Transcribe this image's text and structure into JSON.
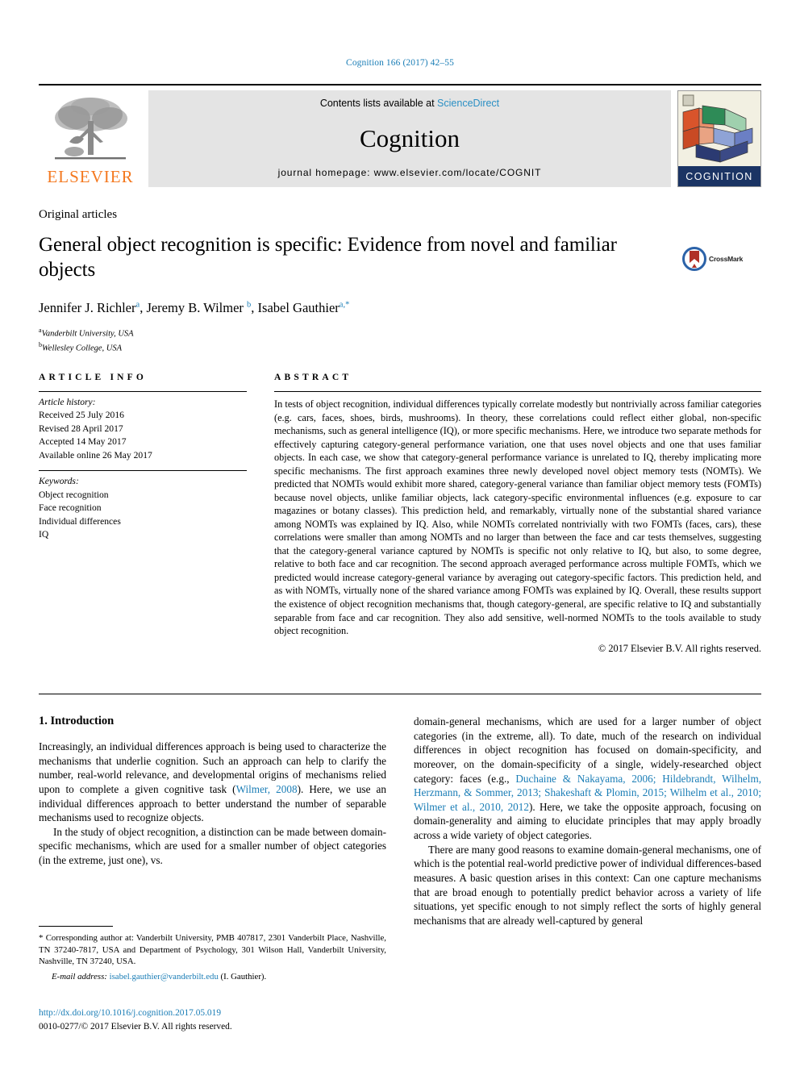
{
  "running_head": "Cognition 166 (2017) 42–55",
  "masthead": {
    "contents_prefix": "Contents lists available at ",
    "contents_link": "ScienceDirect",
    "journal_name": "Cognition",
    "homepage": "journal homepage: www.elsevier.com/locate/COGNIT",
    "publisher_logo_text": "ELSEVIER",
    "cover_band_text": "COGNITION",
    "link_color": "#2a8fc4"
  },
  "article": {
    "article_class": "Original articles",
    "title": "General object recognition is specific: Evidence from novel and familiar objects",
    "crossmark_label": "CrossMark",
    "authors_html": "Jennifer J. Richler<sup>a</sup>, Jeremy B. Wilmer <sup>b</sup>, Isabel Gauthier<sup>a,*</sup>",
    "affiliations": [
      {
        "marker": "a",
        "text": "Vanderbilt University, USA"
      },
      {
        "marker": "b",
        "text": "Wellesley College, USA"
      }
    ]
  },
  "article_info": {
    "heading": "ARTICLE INFO",
    "history_label": "Article history:",
    "history": [
      "Received 25 July 2016",
      "Revised 28 April 2017",
      "Accepted 14 May 2017",
      "Available online 26 May 2017"
    ],
    "keywords_label": "Keywords:",
    "keywords": [
      "Object recognition",
      "Face recognition",
      "Individual differences",
      "IQ"
    ]
  },
  "abstract": {
    "heading": "ABSTRACT",
    "text": "In tests of object recognition, individual differences typically correlate modestly but nontrivially across familiar categories (e.g. cars, faces, shoes, birds, mushrooms). In theory, these correlations could reflect either global, non-specific mechanisms, such as general intelligence (IQ), or more specific mechanisms. Here, we introduce two separate methods for effectively capturing category-general performance variation, one that uses novel objects and one that uses familiar objects. In each case, we show that category-general performance variance is unrelated to IQ, thereby implicating more specific mechanisms. The first approach examines three newly developed novel object memory tests (NOMTs). We predicted that NOMTs would exhibit more shared, category-general variance than familiar object memory tests (FOMTs) because novel objects, unlike familiar objects, lack category-specific environmental influences (e.g. exposure to car magazines or botany classes). This prediction held, and remarkably, virtually none of the substantial shared variance among NOMTs was explained by IQ. Also, while NOMTs correlated nontrivially with two FOMTs (faces, cars), these correlations were smaller than among NOMTs and no larger than between the face and car tests themselves, suggesting that the category-general variance captured by NOMTs is specific not only relative to IQ, but also, to some degree, relative to both face and car recognition. The second approach averaged performance across multiple FOMTs, which we predicted would increase category-general variance by averaging out category-specific factors. This prediction held, and as with NOMTs, virtually none of the shared variance among FOMTs was explained by IQ. Overall, these results support the existence of object recognition mechanisms that, though category-general, are specific relative to IQ and substantially separable from face and car recognition. They also add sensitive, well-normed NOMTs to the tools available to study object recognition.",
    "copyright": "© 2017 Elsevier B.V. All rights reserved."
  },
  "body": {
    "section_heading": "1. Introduction",
    "left_paragraphs": [
      "Increasingly, an individual differences approach is being used to characterize the mechanisms that underlie cognition. Such an approach can help to clarify the number, real-world relevance, and developmental origins of mechanisms relied upon to complete a given cognitive task (<span class=\"lnk\">Wilmer, 2008</span>). Here, we use an individual differences approach to better understand the number of separable mechanisms used to recognize objects.",
      "In the study of object recognition, a distinction can be made between domain-specific mechanisms, which are used for a smaller number of object categories (in the extreme, just one), vs."
    ],
    "right_paragraphs": [
      "domain-general mechanisms, which are used for a larger number of object categories (in the extreme, all). To date, much of the research on individual differences in object recognition has focused on domain-specificity, and moreover, on the domain-specificity of a single, widely-researched object category: faces (e.g., <span class=\"lnk\">Duchaine &amp; Nakayama, 2006; Hildebrandt, Wilhelm, Herzmann, &amp; Sommer, 2013; Shakeshaft &amp; Plomin, 2015; Wilhelm et al., 2010; Wilmer et al., 2010, 2012</span>). Here, we take the opposite approach, focusing on domain-generality and aiming to elucidate principles that may apply broadly across a wide variety of object categories.",
      "There are many good reasons to examine domain-general mechanisms, one of which is the potential real-world predictive power of individual differences-based measures. A basic question arises in this context: Can one capture mechanisms that are broad enough to potentially predict behavior across a variety of life situations, yet specific enough to not simply reflect the sorts of highly general mechanisms that are already well-captured by general"
    ]
  },
  "footnote": {
    "corresponding": "* Corresponding author at: Vanderbilt University, PMB 407817, 2301 Vanderbilt Place, Nashville, TN 37240-7817, USA and Department of Psychology, 301 Wilson Hall, Vanderbilt University, Nashville, TN 37240, USA.",
    "email_label": "E-mail address:",
    "email": "isabel.gauthier@vanderbilt.edu",
    "email_owner": "(I. Gauthier).",
    "doi": "http://dx.doi.org/10.1016/j.cognition.2017.05.019",
    "issn_line": "0010-0277/© 2017 Elsevier B.V. All rights reserved."
  }
}
